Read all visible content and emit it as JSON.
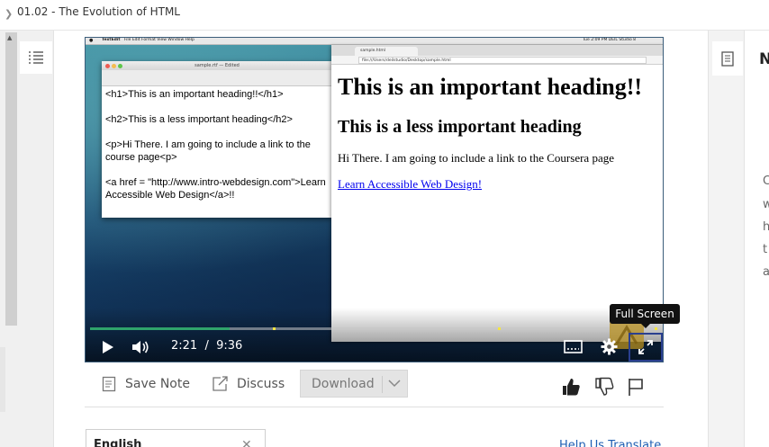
{
  "header": {
    "breadcrumb": "01.02 - The Evolution of HTML"
  },
  "video": {
    "mac_menubar": {
      "app": "TextEdit",
      "menus": "File   Edit   Format   View   Window   Help",
      "status": "Tue 2:09 PM   DEIL Studio 8"
    },
    "textedit": {
      "title": "sample.rtf — Edited",
      "lines": [
        "<h1>This is an important heading!!</h1>",
        "<h2>This is a less important heading</h2>",
        "<p>Hi There.  I am going to include a link to the course page<p>",
        "<a href = \"http://www.intro-webdesign.com\">Learn Accessible Web Design</a>!!"
      ]
    },
    "browser": {
      "tab": "sample.html",
      "url": "file:///Users/deilstudio/Desktop/sample.html",
      "h1": "This is an important heading!!",
      "h2": "This is a less important heading",
      "paragraph": "Hi There. I am going to include a link to the Coursera page",
      "link": "Learn Accessible Web Design!"
    },
    "controls": {
      "current_time": "2:21",
      "separator": "/",
      "duration": "9:36",
      "progress_fraction": 0.245,
      "marker_fractions": [
        0.325,
        0.72,
        0.995
      ],
      "tooltip": "Full Screen"
    }
  },
  "actions": {
    "save_note": "Save Note",
    "discuss": "Discuss",
    "download": "Download"
  },
  "transcript": {
    "language": "English",
    "help_link": "Help Us Translate"
  },
  "right_panel": {
    "heading": "N",
    "text_lines": [
      "C",
      "w",
      "h",
      "t",
      "a"
    ]
  },
  "colors": {
    "progress": "#2fa36b",
    "marker": "#f5e642",
    "link": "#1f5fb3"
  }
}
